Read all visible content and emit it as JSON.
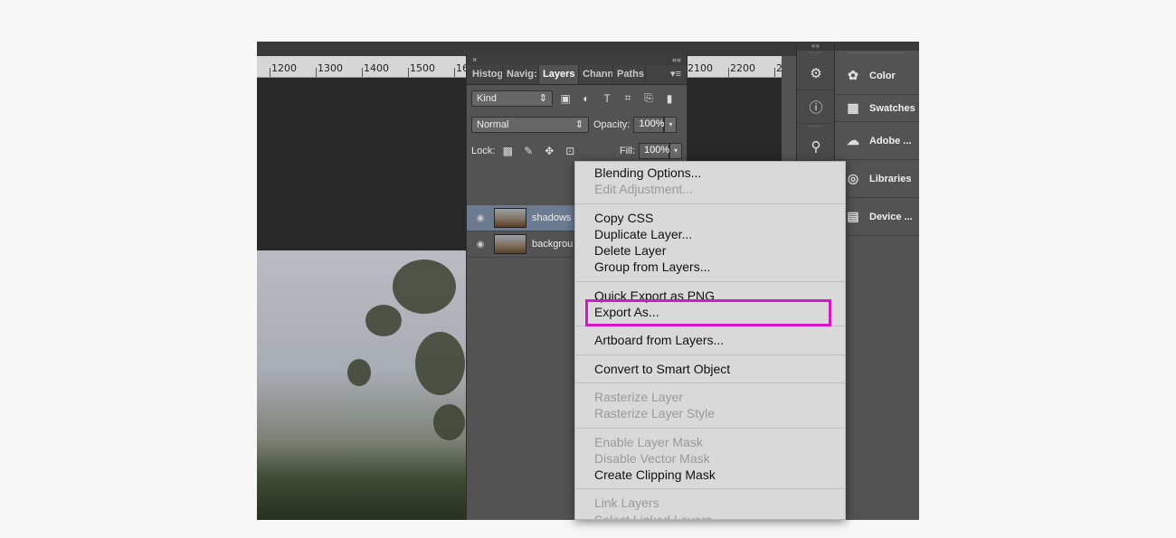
{
  "ruler": {
    "labels": [
      "1200",
      "1300",
      "1400",
      "1500",
      "16",
      "2100",
      "2200",
      "2"
    ]
  },
  "layers_panel": {
    "close_glyph": "×",
    "collapse_glyph": "««",
    "tabs": [
      "Histog",
      "Navig:",
      "Layers",
      "Chann",
      "Paths"
    ],
    "active_tab": "Layers",
    "menu_glyph": "▾≡",
    "filter_kind": "Kind",
    "blend_mode": "Normal",
    "opacity_label": "Opacity:",
    "opacity_value": "100%",
    "lock_label": "Lock:",
    "fill_label": "Fill:",
    "fill_value": "100%",
    "layers": [
      {
        "name": "shadows",
        "selected": true
      },
      {
        "name": "backgrou",
        "selected": false
      }
    ]
  },
  "dock": {
    "collapse_glyph": "««",
    "panels": [
      {
        "label": "Color",
        "icon": "palette-icon"
      },
      {
        "label": "Swatches",
        "icon": "swatches-icon"
      },
      {
        "label": "Adobe ...",
        "icon": "creative-cloud-icon"
      },
      {
        "label": "Libraries",
        "icon": "libraries-icon"
      },
      {
        "label": "Device ...",
        "icon": "device-preview-icon"
      }
    ]
  },
  "context_menu": {
    "groups": [
      [
        {
          "label": "Blending Options...",
          "enabled": true
        },
        {
          "label": "Edit Adjustment...",
          "enabled": false
        }
      ],
      [
        {
          "label": "Copy CSS",
          "enabled": true
        },
        {
          "label": "Duplicate Layer...",
          "enabled": true
        },
        {
          "label": "Delete Layer",
          "enabled": true
        },
        {
          "label": "Group from Layers...",
          "enabled": true
        }
      ],
      [
        {
          "label": "Quick Export as PNG",
          "enabled": true
        },
        {
          "label": "Export As...",
          "enabled": true
        }
      ],
      [
        {
          "label": "Artboard from Layers...",
          "enabled": true
        }
      ],
      [
        {
          "label": "Convert to Smart Object",
          "enabled": true
        }
      ],
      [
        {
          "label": "Rasterize Layer",
          "enabled": false
        },
        {
          "label": "Rasterize Layer Style",
          "enabled": false
        }
      ],
      [
        {
          "label": "Enable Layer Mask",
          "enabled": false
        },
        {
          "label": "Disable Vector Mask",
          "enabled": false
        },
        {
          "label": "Create Clipping Mask",
          "enabled": true
        }
      ],
      [
        {
          "label": "Link Layers",
          "enabled": false
        },
        {
          "label": "Select Linked Layers",
          "enabled": false
        }
      ]
    ],
    "highlighted_item": "Export As...",
    "highlight_color": "#d815c9"
  }
}
